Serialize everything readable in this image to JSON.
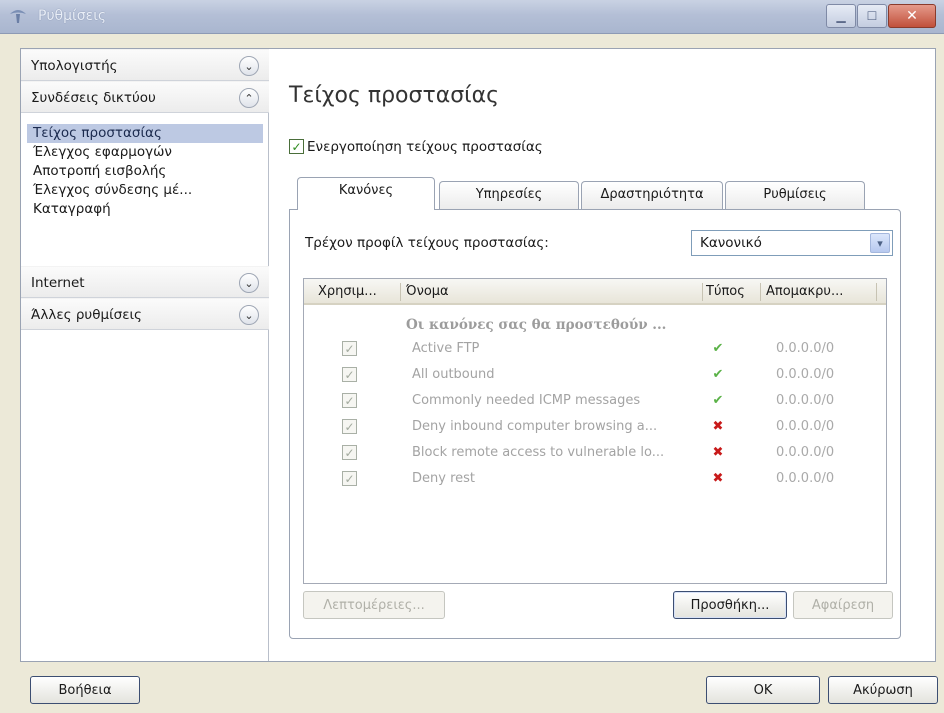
{
  "window": {
    "title": "Ρυθμίσεις"
  },
  "sidebar": {
    "sections": [
      {
        "label": "Υπολογιστής",
        "state": "collapsed"
      },
      {
        "label": "Συνδέσεις δικτύου",
        "state": "expanded",
        "items": [
          {
            "label": "Τείχος προστασίας",
            "selected": true
          },
          {
            "label": "Έλεγχος εφαρμογών"
          },
          {
            "label": "Αποτροπή εισβολής"
          },
          {
            "label": "Έλεγχος σύνδεσης μέ..."
          },
          {
            "label": "Καταγραφή"
          }
        ]
      },
      {
        "label": "Internet",
        "state": "collapsed"
      },
      {
        "label": "Άλλες ρυθμίσεις",
        "state": "collapsed"
      }
    ]
  },
  "main": {
    "title": "Τείχος προστασίας",
    "enable_checkbox": {
      "label": "Ενεργοποίηση τείχους προστασίας",
      "checked": true
    },
    "tabs": [
      {
        "label": "Κανόνες",
        "active": true
      },
      {
        "label": "Υπηρεσίες"
      },
      {
        "label": "Δραστηριότητα"
      },
      {
        "label": "Ρυθμίσεις"
      }
    ],
    "profile": {
      "label": "Τρέχον προφίλ τείχους προστασίας:",
      "value": "Κανονικό"
    },
    "rules_table": {
      "columns": [
        "Χρησιμ...",
        "Όνομα",
        "Τύπος",
        "Απομακρυ..."
      ],
      "group_title": "Οι κανόνες σας θα προστεθούν ...",
      "rows": [
        {
          "checked": true,
          "name": "Active FTP",
          "type": "allow",
          "type_glyph": "✔",
          "address": "0.0.0.0/0"
        },
        {
          "checked": true,
          "name": "All outbound",
          "type": "allow",
          "type_glyph": "✔",
          "address": "0.0.0.0/0"
        },
        {
          "checked": true,
          "name": "Commonly needed ICMP messages",
          "type": "allow",
          "type_glyph": "✔",
          "address": "0.0.0.0/0"
        },
        {
          "checked": true,
          "name": "Deny inbound computer browsing a...",
          "type": "deny",
          "type_glyph": "✖",
          "address": "0.0.0.0/0"
        },
        {
          "checked": true,
          "name": "Block remote access to vulnerable lo...",
          "type": "deny",
          "type_glyph": "✖",
          "address": "0.0.0.0/0"
        },
        {
          "checked": true,
          "name": "Deny rest",
          "type": "deny",
          "type_glyph": "✖",
          "address": "0.0.0.0/0"
        }
      ]
    },
    "buttons": {
      "details": "Λεπτομέρειες...",
      "add": "Προσθήκη...",
      "remove": "Αφαίρεση"
    }
  },
  "footer": {
    "help": "Βοήθεια",
    "ok": "OK",
    "cancel": "Ακύρωση"
  },
  "glyphs": {
    "check": "✓",
    "chevron_down": "⌄",
    "chevron_up": "⌃",
    "combo_arrow": "▾"
  },
  "colors": {
    "selection": "#bdc9e3",
    "allow": "#5ab247",
    "deny": "#c81a1a",
    "titlebar": "#b4bfd6"
  }
}
